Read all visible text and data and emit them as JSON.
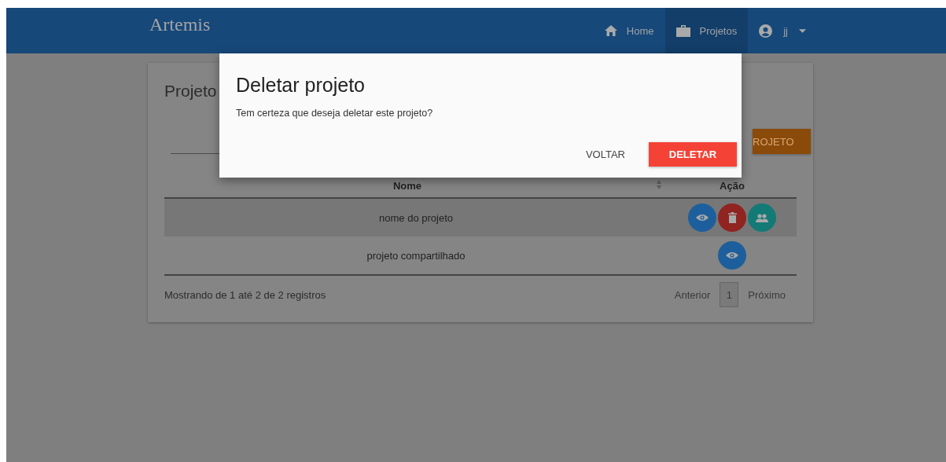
{
  "navbar": {
    "logo": "Artemis",
    "items": [
      {
        "label": "Home",
        "kind": "home",
        "selected": false
      },
      {
        "label": "Projetos",
        "kind": "briefcase",
        "selected": true
      }
    ],
    "user": "jj"
  },
  "card": {
    "title": "Projeto",
    "new_button": "ROJETO",
    "table": {
      "columns": [
        "Nome",
        "Ação"
      ],
      "rows": [
        {
          "name": "nome do projeto",
          "actions": [
            {
              "kind": "view"
            },
            {
              "kind": "delete"
            },
            {
              "kind": "share"
            }
          ],
          "highlighted": true
        },
        {
          "name": "projeto compartilhado",
          "actions": [
            {
              "kind": "view"
            }
          ],
          "highlighted": false
        }
      ]
    },
    "info": "Mostrando de 1 até 2 de 2 registros",
    "pagination": {
      "previous": "Anterior",
      "pages": [
        {
          "label": "1"
        }
      ],
      "next": "Próximo"
    }
  },
  "dialog": {
    "title": "Deletar projeto",
    "message": "Tem certeza que deseja deletar este projeto?",
    "cancel": "VOLTAR",
    "confirm": "DELETAR"
  }
}
